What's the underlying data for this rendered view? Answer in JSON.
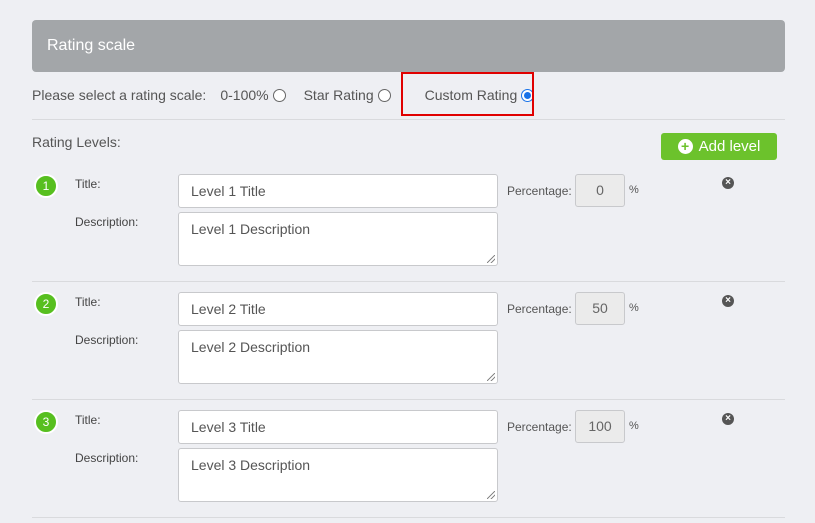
{
  "header": {
    "title": "Rating scale"
  },
  "scale": {
    "prompt": "Please select a rating scale:",
    "options": [
      {
        "label": "0-100%",
        "checked": false
      },
      {
        "label": "Star Rating",
        "checked": false
      },
      {
        "label": "Custom Rating",
        "checked": true
      }
    ]
  },
  "levels_label": "Rating Levels:",
  "add_button": "Add level",
  "field_labels": {
    "title": "Title:",
    "description": "Description:",
    "percentage": "Percentage:",
    "percent_sign": "%"
  },
  "levels": [
    {
      "number": "1",
      "title": "Level 1 Title",
      "description": "Level 1 Description",
      "percentage": "0"
    },
    {
      "number": "2",
      "title": "Level 2 Title",
      "description": "Level 2 Description",
      "percentage": "50"
    },
    {
      "number": "3",
      "title": "Level 3 Title",
      "description": "Level 3 Description",
      "percentage": "100"
    }
  ],
  "colors": {
    "accent_green": "#6cc22c",
    "badge_green": "#57bf1f",
    "header_gray": "#a3a6a9",
    "highlight_red": "#e00000"
  }
}
